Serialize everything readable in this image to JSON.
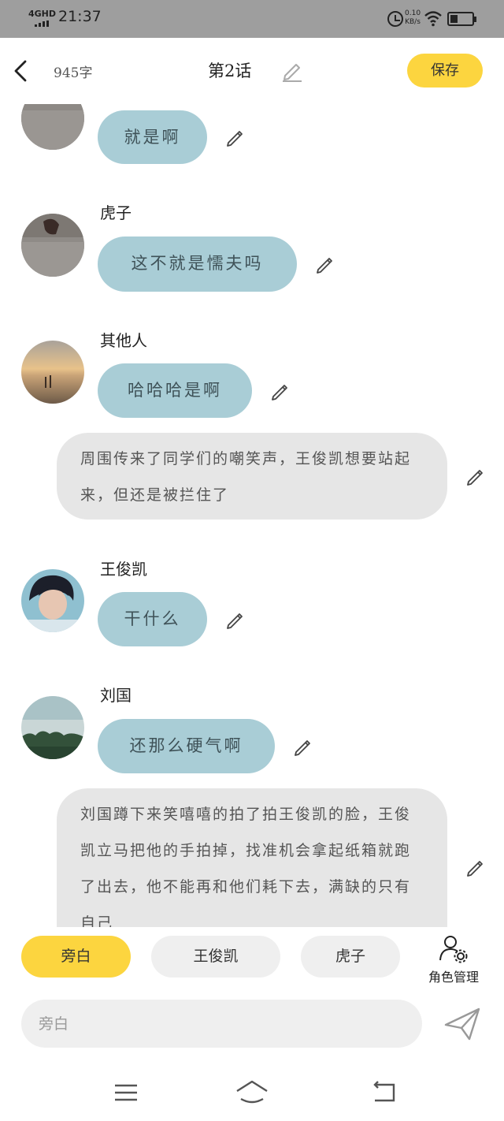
{
  "status_bar": {
    "network": "4GHD",
    "time": "21:37",
    "speed_value": "0.10",
    "speed_unit": "KB/s",
    "battery_level": 0.35
  },
  "header": {
    "back_icon": "chevron-left-icon",
    "word_count": "945字",
    "title": "第2话",
    "edit_icon": "pencil-icon",
    "save_label": "保存"
  },
  "colors": {
    "accent_yellow": "#fcd53f",
    "bubble_blue": "#a9cdd6",
    "narration_gray": "#e6e6e6",
    "chip_gray": "#efefef"
  },
  "messages": [
    {
      "type": "dialogue",
      "speaker": "",
      "text": "就是啊"
    },
    {
      "type": "dialogue",
      "speaker": "虎子",
      "text": "这不就是懦夫吗"
    },
    {
      "type": "dialogue",
      "speaker": "其他人",
      "text": "哈哈哈是啊"
    },
    {
      "type": "narration",
      "text": "周围传来了同学们的嘲笑声，王俊凯想要站起来，但还是被拦住了"
    },
    {
      "type": "dialogue",
      "speaker": "王俊凯",
      "text": "干什么"
    },
    {
      "type": "dialogue",
      "speaker": "刘国",
      "text": "还那么硬气啊"
    },
    {
      "type": "narration",
      "text": "刘国蹲下来笑嘻嘻的拍了拍王俊凯的脸，王俊凯立马把他的手拍掉，找准机会拿起纸箱就跑了出去，他不能再和他们耗下去，满缺的只有自己"
    }
  ],
  "roles": {
    "chips": [
      {
        "label": "旁白",
        "active": true
      },
      {
        "label": "王俊凯",
        "active": false
      },
      {
        "label": "虎子",
        "active": false
      }
    ],
    "manage_label": "角色管理",
    "manage_icon": "user-settings-icon"
  },
  "input": {
    "placeholder": "旁白",
    "value": "",
    "send_icon": "send-icon"
  },
  "nav": {
    "menu_icon": "menu-icon",
    "home_icon": "home-icon",
    "back_icon": "back-icon"
  }
}
